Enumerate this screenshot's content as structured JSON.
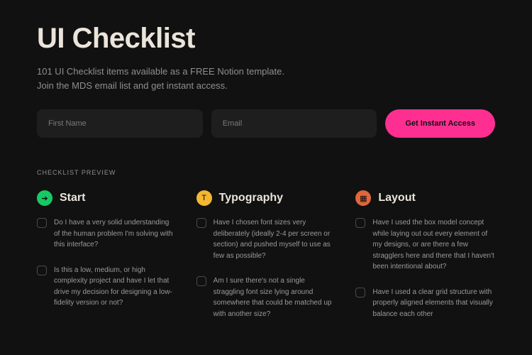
{
  "header": {
    "title": "UI Checklist",
    "subtitle_line1": "101 UI Checklist items available as a FREE Notion template.",
    "subtitle_line2": "Join the MDS email list and get instant access."
  },
  "signup": {
    "first_name_placeholder": "First Name",
    "email_placeholder": "Email",
    "cta_label": "Get Instant Access"
  },
  "preview_label": "CHECKLIST PREVIEW",
  "columns": [
    {
      "icon_glyph": "➔",
      "title": "Start",
      "items": [
        "Do I have a very solid understanding of the human problem I'm solving with this interface?",
        "Is this a low, medium, or high complexity project and have I let that drive my decision for designing a low-fidelity version or not?"
      ]
    },
    {
      "icon_glyph": "T",
      "title": "Typography",
      "items": [
        "Have I chosen font sizes very deliberately (ideally 2-4 per screen or section) and pushed myself to use as few as possible?",
        "Am I sure there's not a single straggling font size lying around somewhere that could be matched up with another size?"
      ]
    },
    {
      "icon_glyph": "▦",
      "title": "Layout",
      "items": [
        "Have I used the box model concept while laying out out every element of my designs, or are there a few stragglers here and there that I haven't been intentional about?",
        "Have I used a clear grid structure with properly aligned elements that visually balance each other"
      ]
    }
  ]
}
